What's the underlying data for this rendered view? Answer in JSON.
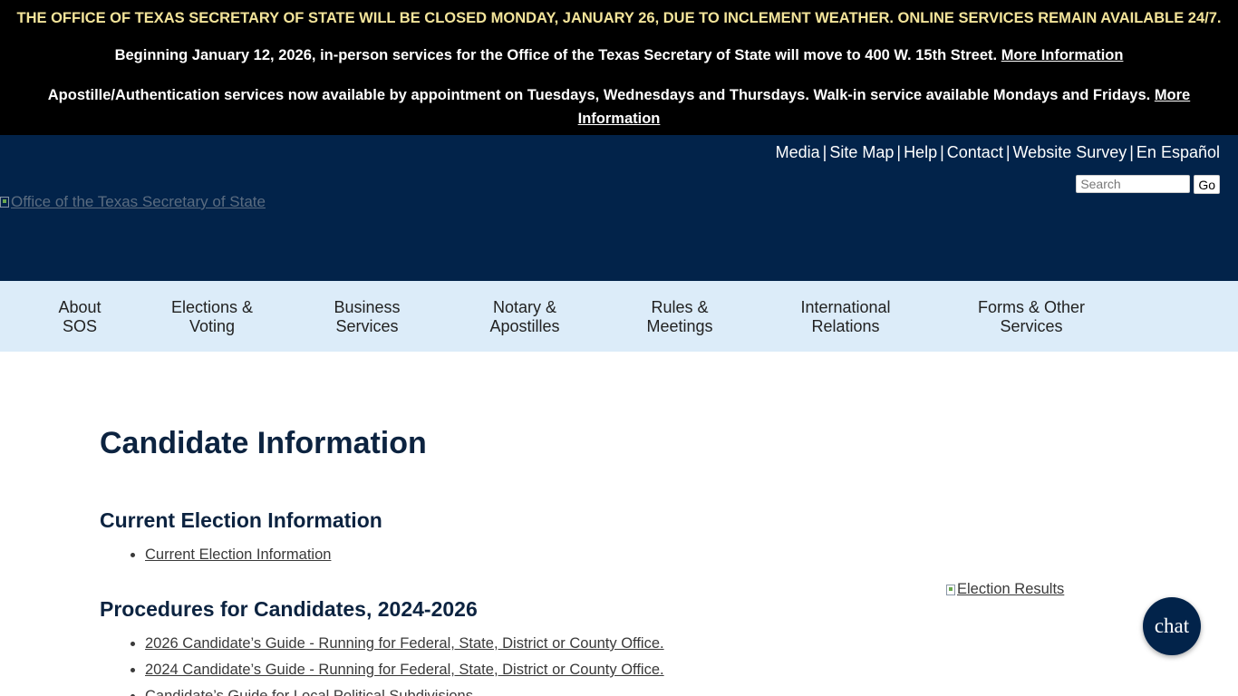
{
  "alerts": {
    "closure": "THE OFFICE OF TEXAS SECRETARY OF STATE WILL BE CLOSED MONDAY, JANUARY 26, DUE TO INCLEMENT WEATHER. ONLINE SERVICES REMAIN AVAILABLE 24/7.",
    "move_text": "Beginning January 12, 2026, in-person services for the Office of the Texas Secretary of State will move to 400 W. 15th Street.",
    "move_link": "More Information",
    "apostille_text": "Apostille/Authentication services now available by appointment on Tuesdays, Wednesdays and Thursdays. Walk-in service available Mondays and Fridays.",
    "apostille_link": "More Information"
  },
  "header": {
    "logo_alt": "Office of the Texas Secretary of State",
    "util_links": [
      "Media",
      "Site Map",
      "Help",
      "Contact",
      "Website Survey",
      "En Español"
    ],
    "search_placeholder": "Search",
    "search_button": "Go"
  },
  "nav": [
    {
      "line1": "About",
      "line2": "SOS"
    },
    {
      "line1": "Elections &",
      "line2": "Voting"
    },
    {
      "line1": "Business",
      "line2": "Services"
    },
    {
      "line1": "Notary &",
      "line2": "Apostilles"
    },
    {
      "line1": "Rules &",
      "line2": "Meetings"
    },
    {
      "line1": "International",
      "line2": "Relations"
    },
    {
      "line1": "Forms & Other",
      "line2": "Services"
    }
  ],
  "content": {
    "title": "Candidate Information",
    "current_heading": "Current Election Information",
    "current_links": [
      "Current Election Information"
    ],
    "procedures_heading": "Procedures for Candidates, 2024-2026",
    "procedures_links": [
      "2026 Candidate’s Guide - Running for Federal, State, District or County Office.",
      "2024 Candidate’s Guide - Running for Federal, State, District or County Office.",
      "Candidate’s Guide for Local Political Subdivisions"
    ],
    "side_image_alt": "Election Results"
  },
  "chat": {
    "label": "chat"
  },
  "colors": {
    "header_bg": "#02234a",
    "nav_bg": "#dcecf9",
    "alert_highlight": "#f3e49a",
    "heading": "#0c2340"
  }
}
